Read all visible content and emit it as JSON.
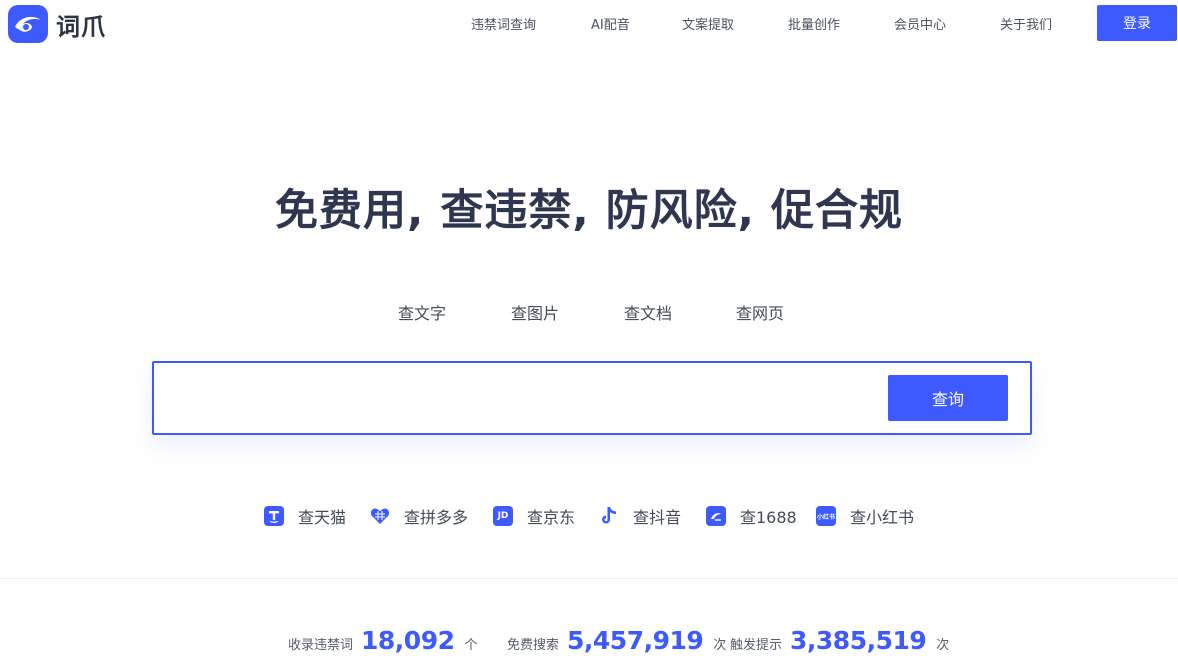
{
  "brand": {
    "name": "词爪",
    "logo_icon": "eye-logo-icon",
    "accent": "#3d5afe"
  },
  "nav": {
    "items": [
      "违禁词查询",
      "AI配音",
      "文案提取",
      "批量创作",
      "会员中心",
      "关于我们"
    ],
    "login_label": "登录"
  },
  "hero": {
    "title": "免费用, 查违禁, 防风险, 促合规"
  },
  "tabs": [
    "查文字",
    "查图片",
    "查文档",
    "查网页"
  ],
  "search": {
    "value": "",
    "placeholder": "",
    "button_label": "查询"
  },
  "platforms": [
    {
      "label": "查天猫",
      "icon": "tmall-icon",
      "glyph": "T"
    },
    {
      "label": "查拼多多",
      "icon": "pinduoduo-icon",
      "glyph": ""
    },
    {
      "label": "查京东",
      "icon": "jd-icon",
      "glyph": "JD"
    },
    {
      "label": "查抖音",
      "icon": "douyin-icon",
      "glyph": ""
    },
    {
      "label": "查1688",
      "icon": "1688-icon",
      "glyph": ""
    },
    {
      "label": "查小红书",
      "icon": "xiaohongshu-icon",
      "glyph": "小红书"
    }
  ],
  "stats": [
    {
      "label": "收录违禁词",
      "value": "18,092",
      "unit": "个"
    },
    {
      "label": "免费搜索",
      "value": "5,457,919",
      "unit": "次"
    },
    {
      "label": "触发提示",
      "value": "3,385,519",
      "unit": "次"
    }
  ]
}
